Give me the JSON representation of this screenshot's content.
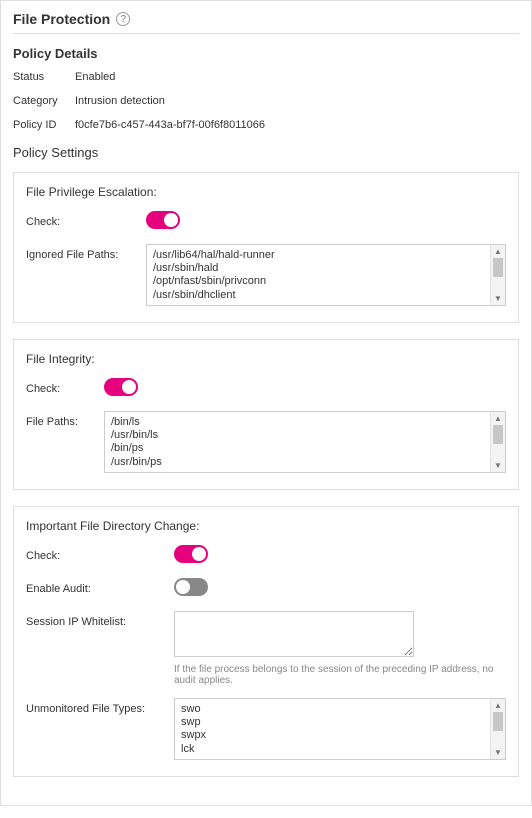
{
  "header": {
    "title": "File Protection",
    "help_icon": "?"
  },
  "details": {
    "section_title": "Policy Details",
    "status_label": "Status",
    "status_value": "Enabled",
    "category_label": "Category",
    "category_value": "Intrusion detection",
    "policy_id_label": "Policy ID",
    "policy_id_value": "f0cfe7b6-c457-443a-bf7f-00f6f8011066"
  },
  "settings": {
    "section_title": "Policy Settings",
    "escalation": {
      "title": "File Privilege Escalation:",
      "check_label": "Check:",
      "check_on": true,
      "ignored_label": "Ignored File Paths:",
      "ignored_paths": [
        "/usr/lib64/hal/hald-runner",
        "/usr/sbin/hald",
        "/opt/nfast/sbin/privconn",
        "/usr/sbin/dhclient"
      ]
    },
    "integrity": {
      "title": "File Integrity:",
      "check_label": "Check:",
      "check_on": true,
      "paths_label": "File Paths:",
      "paths": [
        "/bin/ls",
        "/usr/bin/ls",
        "/bin/ps",
        "/usr/bin/ps"
      ]
    },
    "dirchange": {
      "title": "Important File Directory Change:",
      "check_label": "Check:",
      "check_on": true,
      "audit_label": "Enable Audit:",
      "audit_on": false,
      "whitelist_label": "Session IP Whitelist:",
      "whitelist_value": "",
      "whitelist_hint": "If the file process belongs to the session of the preceding IP address, no audit applies.",
      "types_label": "Unmonitored File Types:",
      "types": [
        "swo",
        "swp",
        "swpx",
        "lck"
      ]
    }
  }
}
